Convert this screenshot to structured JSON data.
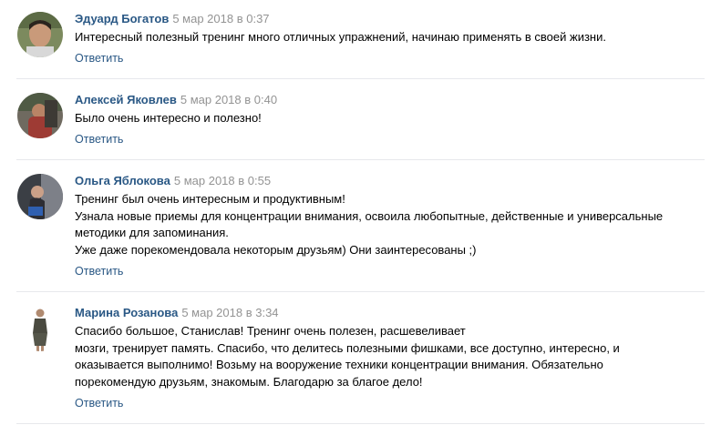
{
  "comments": [
    {
      "author": "Эдуард Богатов",
      "date": "5 мар 2018 в 0:37",
      "lines": [
        "Интересный полезный тренинг много отличных упражнений, начинаю применять в своей жизни."
      ],
      "reply": "Ответить"
    },
    {
      "author": "Алексей Яковлев",
      "date": "5 мар 2018 в 0:40",
      "lines": [
        "Было очень интересно и полезно!"
      ],
      "reply": "Ответить"
    },
    {
      "author": "Ольга Яблокова",
      "date": "5 мар 2018 в 0:55",
      "lines": [
        "Тренинг был очень интересным и продуктивным!",
        "Узнала новые приемы для концентрации внимания, освоила любопытные, действенные и универсальные",
        "методики для запоминания.",
        "Уже даже порекомендовала некоторым друзьям) Они заинтересованы ;)"
      ],
      "reply": "Ответить"
    },
    {
      "author": "Марина Розанова",
      "date": "5 мар 2018 в 3:34",
      "lines": [
        "Спасибо большое, Станислав! Тренинг очень полезен, расшевеливает",
        "мозги, тренирует память. Спасибо, что делитесь полезными фишками, все доступно, интересно, и",
        "оказывается выполнимо! Возьму на вооружение техники концентрации внимания. Обязательно",
        "порекомендую друзьям, знакомым. Благодарю за благое дело!"
      ],
      "reply": "Ответить"
    }
  ],
  "colors": {
    "author": "#2a5885",
    "date": "#939393",
    "link": "#2a5885",
    "divider": "#e7e8ec"
  },
  "icons": [
    "avatar-photo"
  ]
}
